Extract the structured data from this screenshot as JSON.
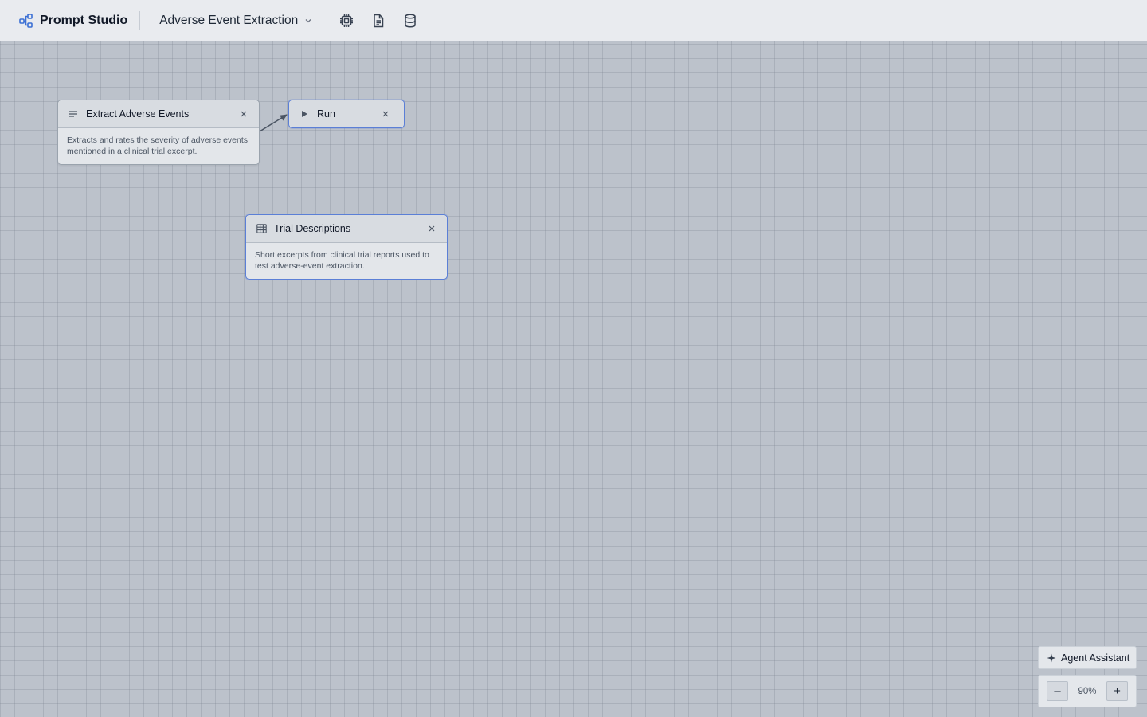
{
  "app": {
    "name": "Prompt Studio",
    "brand_color": "#3b6fd4"
  },
  "header": {
    "project_name": "Adverse Event Extraction",
    "tools": [
      {
        "icon": "cpu-chip-icon"
      },
      {
        "icon": "document-icon"
      },
      {
        "icon": "database-icon"
      }
    ]
  },
  "nodes": {
    "prompt": {
      "title": "Extract Adverse Events",
      "icon": "lines-icon",
      "description": "Extracts and rates the severity of adverse events mentioned in a clinical trial excerpt."
    },
    "run": {
      "title": "Run",
      "icon": "play-icon",
      "selected": true
    },
    "dataset": {
      "title": "Trial Descriptions",
      "icon": "table-icon",
      "description": "Short excerpts from clinical trial reports used to test adverse-event extraction.",
      "selected": true
    }
  },
  "agent": {
    "label": "Agent Assistant",
    "icon": "sparkle-icon"
  },
  "zoom": {
    "level": "90%",
    "minus_label": "–",
    "plus_label": "+"
  },
  "colors": {
    "canvas_bg": "#bcc2cb",
    "selected_border": "#5b7fd6",
    "edge": "#4b5563"
  }
}
